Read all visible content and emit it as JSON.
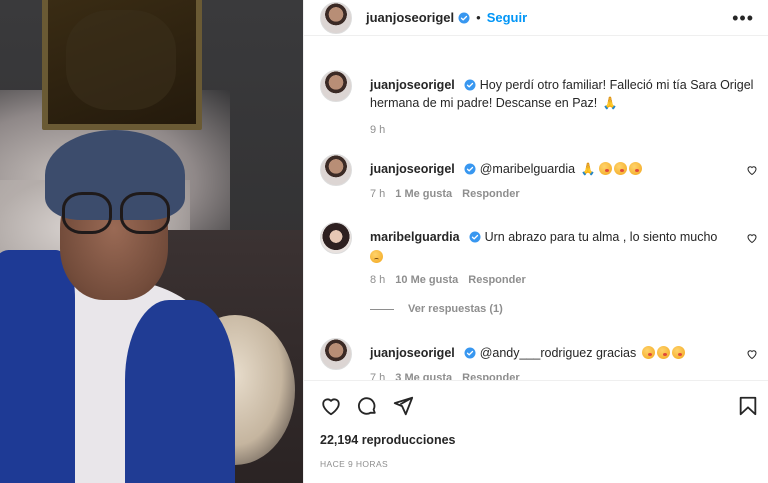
{
  "post": {
    "author": "juanjoseorigel",
    "follow_label": "Seguir",
    "dot": "•",
    "more_label": "•••"
  },
  "comments": [
    {
      "username": "juanjoseorigel",
      "text": "Hoy perdí otro familiar! Falleció mi tía Sara Origel hermana de mi padre! Descanse en Paz!",
      "time": "9 h"
    },
    {
      "username": "juanjoseorigel",
      "text": "@maribelguardia",
      "time": "7 h",
      "likes": "1 Me gusta",
      "reply": "Responder"
    },
    {
      "username": "maribelguardia",
      "text": "Urn abrazo para tu alma , lo siento mucho",
      "time": "8 h",
      "likes": "10 Me gusta",
      "reply": "Responder"
    },
    {
      "username": "juanjoseorigel",
      "text": "@andy___rodriguez gracias",
      "time": "7 h",
      "likes": "3 Me gusta",
      "reply": "Responder"
    }
  ],
  "view_replies": "Ver respuestas (1)",
  "stats": {
    "views": "22,194 reproducciones",
    "posted": "HACE 9 HORAS"
  },
  "icons": {
    "like": "heart-icon",
    "comment": "comment-icon",
    "share": "share-icon",
    "save": "bookmark-icon",
    "verified": "verified-badge-icon"
  },
  "colors": {
    "accent": "#0095f6",
    "verified": "#3897f0",
    "muted": "#8e8e8e",
    "text": "#262626"
  }
}
